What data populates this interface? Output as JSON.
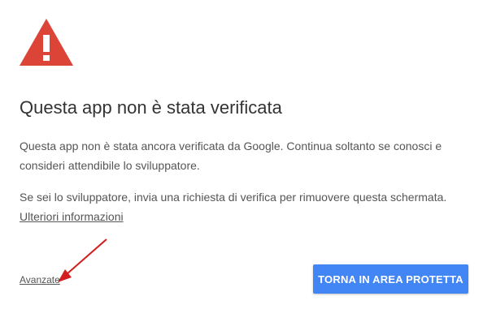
{
  "icons": {
    "warning": "warning-triangle-icon",
    "annotation": "red-arrow"
  },
  "colors": {
    "warning_red": "#db4437",
    "button_blue": "#4285f4",
    "arrow_red": "#d21f1f"
  },
  "title": "Questa app non è stata verificata",
  "paragraph1": "Questa app non è stata ancora verificata da Google. Continua soltanto se conosci e consideri attendibile lo sviluppatore.",
  "paragraph2_text": "Se sei lo sviluppatore, invia una richiesta di verifica per rimuovere questa schermata.",
  "more_info_link": "Ulteriori informazioni",
  "advanced_link": "Avanzate",
  "back_button": "TORNA IN AREA PROTETTA"
}
